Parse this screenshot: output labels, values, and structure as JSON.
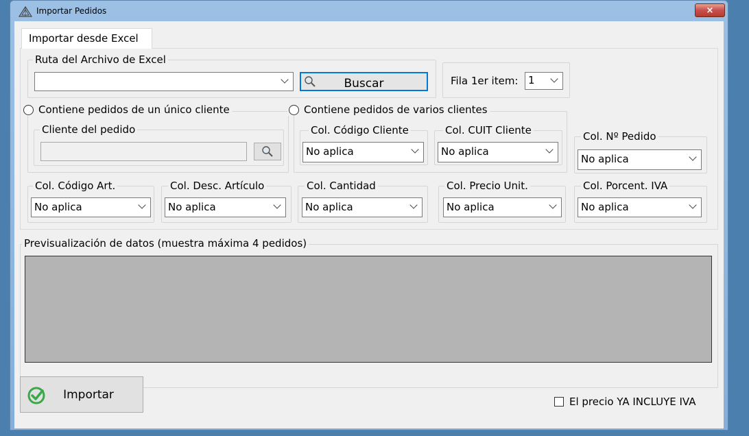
{
  "window": {
    "title": "Importar Pedidos",
    "close_icon": "×"
  },
  "tab": {
    "label": "Importar desde Excel"
  },
  "file_group": {
    "label": "Ruta del Archivo de Excel",
    "path_value": "",
    "search_button": "Buscar"
  },
  "row_group": {
    "label": "Fila 1er item:",
    "value": "1"
  },
  "single_client": {
    "radio_label": "Contiene pedidos de un único cliente",
    "client_label": "Cliente del pedido",
    "client_value": ""
  },
  "multi_client": {
    "radio_label": "Contiene pedidos de varios clientes",
    "col_codigo_cliente": {
      "label": "Col. Código Cliente",
      "value": "No aplica"
    },
    "col_cuit_cliente": {
      "label": "Col. CUIT Cliente",
      "value": "No aplica"
    }
  },
  "col_nro_pedido": {
    "label": "Col. Nº Pedido",
    "value": "No aplica"
  },
  "columns": {
    "codigo_art": {
      "label": "Col. Código Art.",
      "value": "No aplica"
    },
    "desc_articulo": {
      "label": "Col. Desc. Artículo",
      "value": "No aplica"
    },
    "cantidad": {
      "label": "Col. Cantidad",
      "value": "No aplica"
    },
    "precio_unit": {
      "label": "Col.  Precio Unit.",
      "value": "No aplica"
    },
    "porcent_iva": {
      "label": "Col.  Porcent. IVA",
      "value": "No aplica"
    }
  },
  "preview": {
    "label": "Previsualización de datos (muestra máxima 4 pedidos)"
  },
  "import_button": {
    "label": "Importar"
  },
  "iva_checkbox": {
    "label": "El precio YA INCLUYE IVA",
    "checked": false
  },
  "colors": {
    "accent_green": "#3aa84a",
    "preview_bg": "#b4b4b4",
    "focus_border": "#0078d7"
  }
}
